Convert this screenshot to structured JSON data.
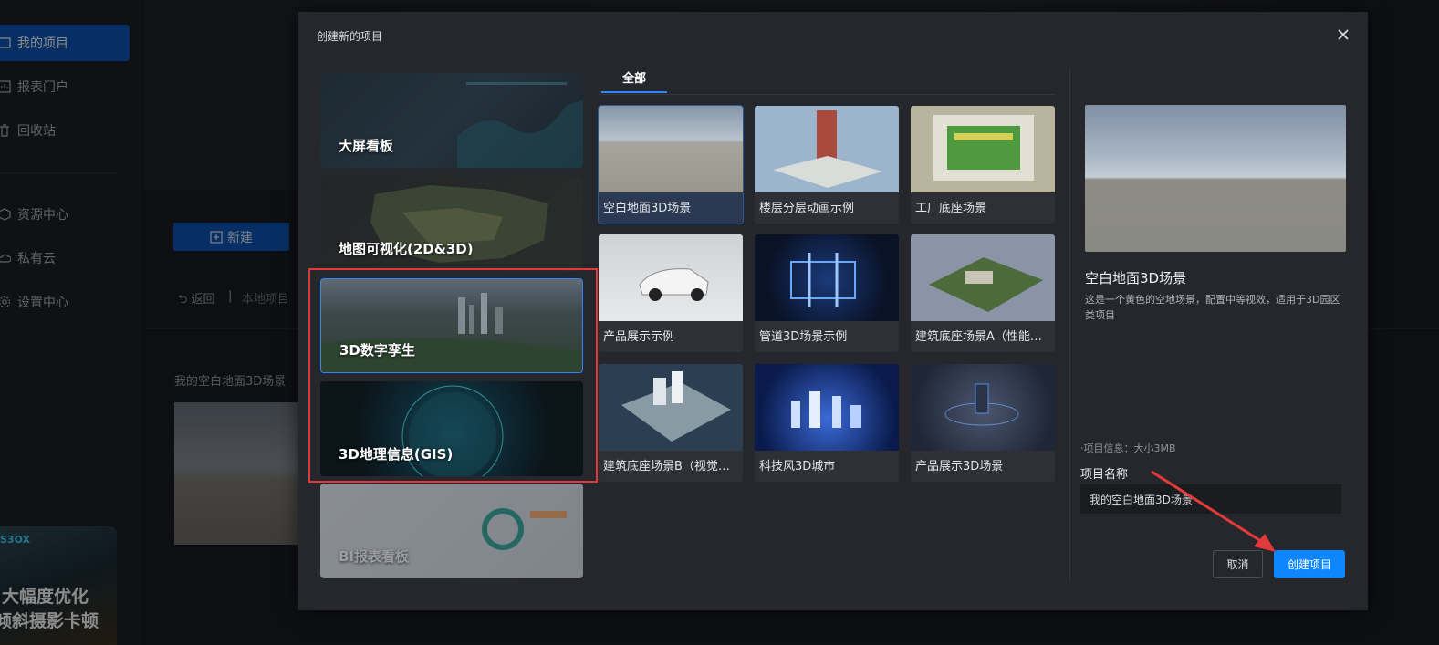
{
  "sidebar": {
    "items": [
      {
        "label": "我的项目",
        "icon": "project-icon",
        "active": true
      },
      {
        "label": "报表门户",
        "icon": "report-icon",
        "active": false
      },
      {
        "label": "回收站",
        "icon": "trash-icon",
        "active": false
      },
      {
        "label": "资源中心",
        "icon": "cube-icon",
        "active": false
      },
      {
        "label": "私有云",
        "icon": "cloud-icon",
        "active": false
      },
      {
        "label": "设置中心",
        "icon": "gear-icon",
        "active": false
      }
    ],
    "promo": {
      "logo": "S3OX",
      "line1": "大幅度优化",
      "line2": "倾斜摄影卡顿"
    }
  },
  "background": {
    "new_label": "新建",
    "back_label": "返回",
    "separator": "|",
    "local_label": "本地项目",
    "card_title": "我的空白地面3D场景"
  },
  "modal": {
    "title": "创建新的项目",
    "categories": [
      {
        "label": "大屏看板",
        "selected": false
      },
      {
        "label": "地图可视化(2D&3D)",
        "selected": false
      },
      {
        "label": "3D数字孪生",
        "selected": true
      },
      {
        "label": "3D地理信息(GIS)",
        "selected": false
      },
      {
        "label": "BI报表看板",
        "selected": false
      }
    ],
    "tab": "全部",
    "templates": [
      {
        "name": "空白地面3D场景",
        "selected": true
      },
      {
        "name": "楼层分层动画示例",
        "selected": false
      },
      {
        "name": "工厂底座场景",
        "selected": false
      },
      {
        "name": "产品展示示例",
        "selected": false
      },
      {
        "name": "管道3D场景示例",
        "selected": false
      },
      {
        "name": "建筑底座场景A（性能优化）",
        "selected": false
      },
      {
        "name": "建筑底座场景B（视觉优化）",
        "selected": false
      },
      {
        "name": "科技风3D城市",
        "selected": false
      },
      {
        "name": "产品展示3D场景",
        "selected": false
      }
    ],
    "detail": {
      "title": "空白地面3D场景",
      "description": "这是一个黄色的空地场景，配置中等视效，适用于3D园区类项目",
      "info": "·项目信息：大小3MB",
      "name_label": "项目名称",
      "name_value": "我的空白地面3D场景"
    },
    "cancel_label": "取消",
    "create_label": "创建项目"
  },
  "colors": {
    "accent": "#0e86ff",
    "highlight": "#e23a3a",
    "sidebar_active": "#0d57b8"
  }
}
